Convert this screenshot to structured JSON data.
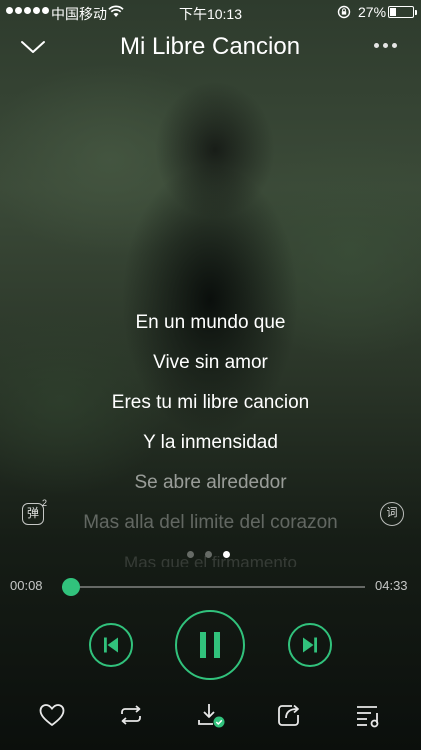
{
  "status_bar": {
    "carrier": "中国移动",
    "time": "下午10:13",
    "battery_percent": "27%",
    "battery_level": 0.27,
    "icons": [
      "signal-dots",
      "wifi-icon",
      "rotation-lock-icon",
      "battery-icon"
    ]
  },
  "header": {
    "title": "Mi Libre Cancion",
    "icons": [
      "chevron-down-icon",
      "more-icon"
    ]
  },
  "lyrics": {
    "lines": [
      "En un mundo que",
      "Vive sin amor",
      "Eres tu mi libre cancion",
      "Y la inmensidad",
      "Se abre alrededor",
      "Mas alla del limite del corazon",
      "Mas que el firmamento"
    ]
  },
  "side_buttons": {
    "danmaku_glyph": "弹",
    "danmaku_sup": "2",
    "lyric_search_glyph": "词"
  },
  "pager": {
    "pages": 3,
    "active_index": 2
  },
  "progress": {
    "elapsed": "00:08",
    "total": "04:33",
    "fraction": 0.029
  },
  "controls": {
    "icons": [
      "previous-icon",
      "pause-icon",
      "next-icon"
    ],
    "state": "playing"
  },
  "toolbar": {
    "icons": [
      "heart-icon",
      "repeat-icon",
      "download-done-icon",
      "share-icon",
      "playlist-icon"
    ]
  },
  "colors": {
    "accent": "#31c27c",
    "text": "#ffffff"
  }
}
